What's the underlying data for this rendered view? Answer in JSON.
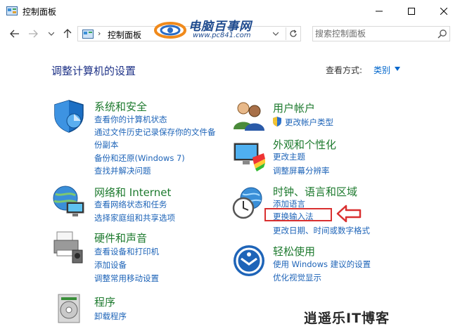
{
  "window": {
    "title": "控制面板"
  },
  "address": {
    "separator": "›",
    "path": "控制面板"
  },
  "search": {
    "placeholder": "搜索控制面板"
  },
  "watermark": {
    "site_name": "电脑百事网",
    "site_url": "www.pc841.com",
    "bottom_text": "逍遥乐IT博客"
  },
  "main": {
    "heading": "调整计算机的设置",
    "view_by_label": "查看方式:",
    "view_by_value": "类别"
  },
  "categories": [
    {
      "title": "系统和安全",
      "icon": "shield-icon",
      "links": [
        "查看你的计算机状态",
        "通过文件历史记录保存你的文件备",
        "份副本",
        "备份和还原(Windows 7)",
        "查找并解决问题"
      ]
    },
    {
      "title": "网络和 Internet",
      "icon": "network-globe-icon",
      "links": [
        "查看网络状态和任务",
        "选择家庭组和共享选项"
      ]
    },
    {
      "title": "硬件和声音",
      "icon": "printer-icon",
      "links": [
        "查看设备和打印机",
        "添加设备",
        "调整常用移动设置"
      ]
    },
    {
      "title": "程序",
      "icon": "programs-disc-icon",
      "links": [
        "卸载程序"
      ]
    },
    {
      "title": "用户帐户",
      "icon": "users-icon",
      "links": [
        "更改帐户类型"
      ]
    },
    {
      "title": "外观和个性化",
      "icon": "monitor-palette-icon",
      "links": [
        "更改主题",
        "调整屏幕分辨率"
      ]
    },
    {
      "title": "时钟、语言和区域",
      "icon": "clock-globe-icon",
      "links": [
        "添加语言",
        "更换输入法",
        "更改日期、时间或数字格式"
      ]
    },
    {
      "title": "轻松使用",
      "icon": "ease-of-access-icon",
      "links": [
        "使用 Windows 建议的设置",
        "优化视觉显示"
      ]
    }
  ],
  "colors": {
    "category_title": "#1d7a2e",
    "link": "#1e64b8",
    "heading": "#1e3287",
    "highlight": "#d93030"
  }
}
